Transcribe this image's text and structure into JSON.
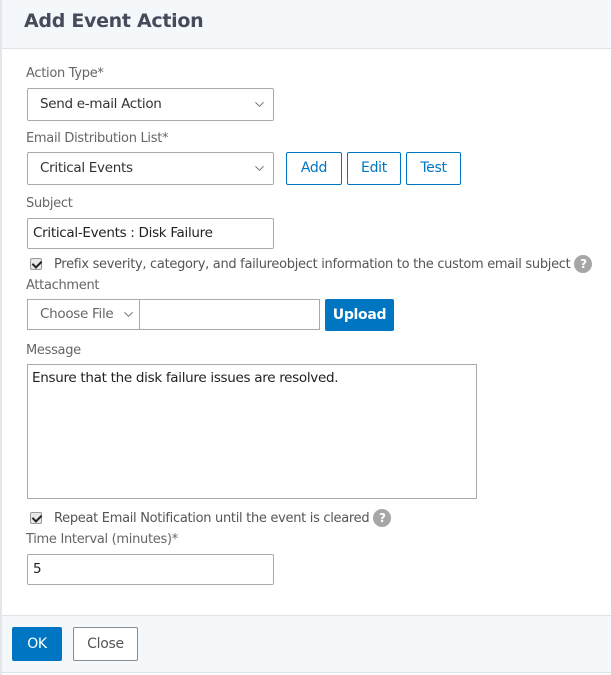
{
  "dialog": {
    "title": "Add Event Action"
  },
  "form": {
    "action_type": {
      "label": "Action Type*",
      "value": "Send e-mail Action"
    },
    "distribution_list": {
      "label": "Email Distribution List*",
      "value": "Critical Events",
      "add_label": "Add",
      "edit_label": "Edit",
      "test_label": "Test"
    },
    "subject": {
      "label": "Subject",
      "value": "Critical-Events : Disk Failure"
    },
    "prefix_checkbox": {
      "label": "Prefix severity, category, and failureobject information to the custom email subject",
      "checked": true,
      "help": "?"
    },
    "attachment": {
      "label": "Attachment",
      "choose_file": "Choose File",
      "file_value": "",
      "upload_label": "Upload"
    },
    "message": {
      "label": "Message",
      "value": "Ensure that the disk failure issues are resolved."
    },
    "repeat_checkbox": {
      "label": "Repeat Email Notification until the event is cleared",
      "checked": true,
      "help": "?"
    },
    "time_interval": {
      "label": "Time Interval (minutes)*",
      "value": "5"
    }
  },
  "footer": {
    "ok_label": "OK",
    "close_label": "Close"
  },
  "colors": {
    "primary": "#0075c2",
    "header_bg": "#f5f8fb"
  }
}
